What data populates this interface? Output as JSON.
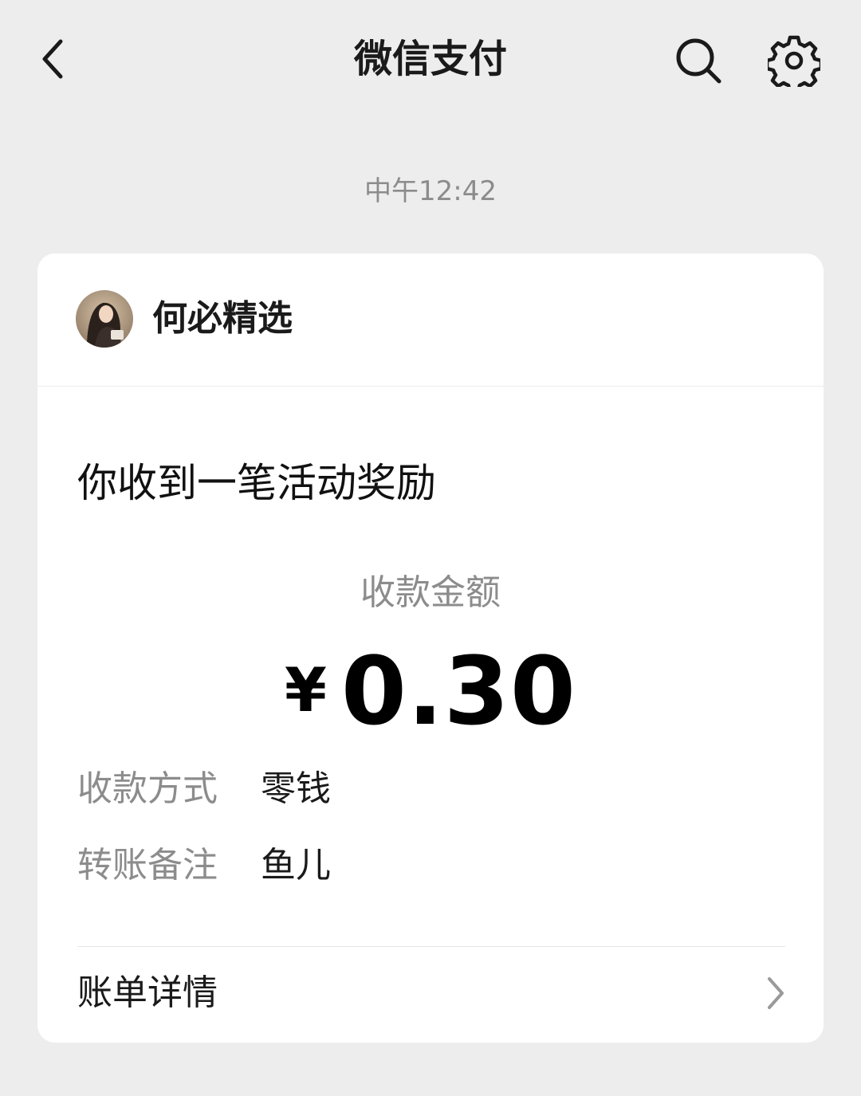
{
  "nav": {
    "title": "微信支付",
    "back_icon": "chevron-left-icon",
    "search_icon": "search-icon",
    "settings_icon": "gear-icon"
  },
  "timestamp": "中午12:42",
  "card": {
    "merchant": {
      "name": "何必精选",
      "avatar_icon": "avatar"
    },
    "headline": "你收到一笔活动奖励",
    "amount_label": "收款金额",
    "currency": "¥",
    "amount": "0.30",
    "details": [
      {
        "key": "收款方式",
        "value": "零钱"
      },
      {
        "key": "转账备注",
        "value": "鱼儿"
      }
    ],
    "bill_details_label": "账单详情",
    "bill_chevron_icon": "chevron-right-icon"
  },
  "colors": {
    "background": "#ededed",
    "card": "#ffffff",
    "secondary_text": "#8c8c8c",
    "primary_text": "#1a1a1a"
  }
}
